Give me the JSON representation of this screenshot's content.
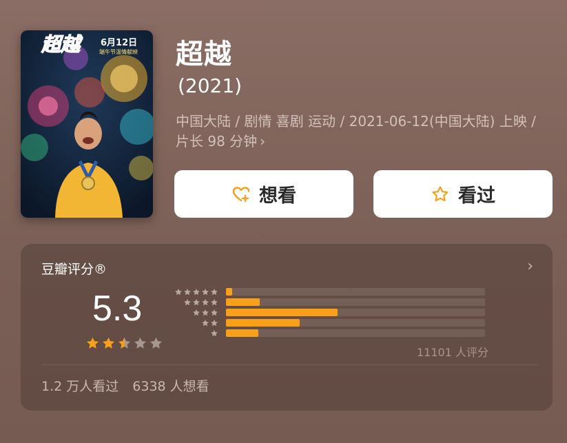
{
  "movie": {
    "title": "超越",
    "year": "(2021)",
    "meta": "中国大陆 / 剧情 喜剧 运动 / 2021-06-12(中国大陆) 上映 / 片长 98 分钟",
    "meta_chevron": "›"
  },
  "poster": {
    "title_text": "超越",
    "date_text": "6月12日",
    "sub_text": "端午节温情献映"
  },
  "actions": {
    "want_label": "想看",
    "seen_label": "看过",
    "want_icon": "heart-plus-icon",
    "seen_icon": "star-outline-icon"
  },
  "rating": {
    "header": "豆瓣评分®",
    "header_chevron": "›",
    "score": "5.3",
    "stars_value": 2.5,
    "stars_max": 5,
    "distribution": [
      {
        "stars": 5,
        "fraction": 0.025
      },
      {
        "stars": 4,
        "fraction": 0.13
      },
      {
        "stars": 3,
        "fraction": 0.43
      },
      {
        "stars": 2,
        "fraction": 0.285
      },
      {
        "stars": 1,
        "fraction": 0.125
      }
    ],
    "count_text": "11101 人评分",
    "seen_text": "1.2 万人看过",
    "want_text": "6338 人想看"
  },
  "colors": {
    "accent_orange": "#f8a01c",
    "background": "#7d6259",
    "star_gray": "#a89690"
  }
}
